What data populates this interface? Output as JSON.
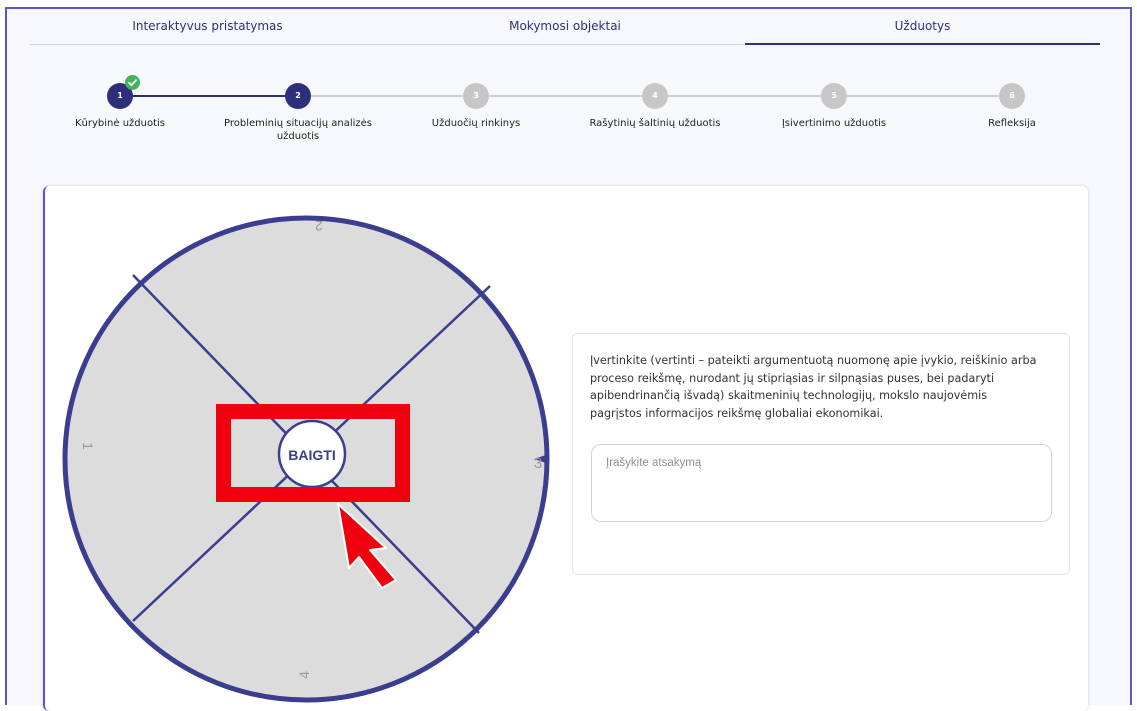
{
  "tabs": [
    {
      "label": "Interaktyvus pristatymas"
    },
    {
      "label": "Mokymosi objektai"
    },
    {
      "label": "Užduotys"
    }
  ],
  "active_tab": "Užduotys",
  "steps": [
    {
      "number": "1",
      "label": "Kūrybinė užduotis",
      "state": "completed"
    },
    {
      "number": "2",
      "label": "Probleminių situacijų analizės užduotis",
      "state": "active"
    },
    {
      "number": "3",
      "label": "Užduočių rinkinys",
      "state": "pending"
    },
    {
      "number": "4",
      "label": "Rašytinių šaltinių užduotis",
      "state": "pending"
    },
    {
      "number": "5",
      "label": "Įsivertinimo užduotis",
      "state": "pending"
    },
    {
      "number": "6",
      "label": "Refleksija",
      "state": "pending"
    }
  ],
  "wheel": {
    "segment_labels": [
      "1",
      "2",
      "3",
      "4"
    ],
    "center_button": "BAIGTI"
  },
  "task": {
    "instruction": "Įvertinkite (vertinti – pateikti argumentuotą nuomonę apie įvykio, reiškinio arba proceso reikšmę, nurodant jų stipriąsias ir silpnąsias puses, bei padaryti apibendrinančią išvadą) skaitmeninių technologijų, mokslo naujovėmis pagrįstos informacijos reikšmę globaliai ekonomikai.",
    "answer_placeholder": "Įrašykite atsakymą",
    "answer_value": ""
  },
  "colors": {
    "primary": "#2d2f7a",
    "wheel_fill": "#dcdcdc",
    "wheel_border": "#3b3d8f",
    "pending_step": "#c7c7c7",
    "check_green": "#41b45a",
    "annotation_red": "#f0000e"
  },
  "icons": {
    "check": "check-icon",
    "pointer": "cursor-arrow-icon"
  }
}
